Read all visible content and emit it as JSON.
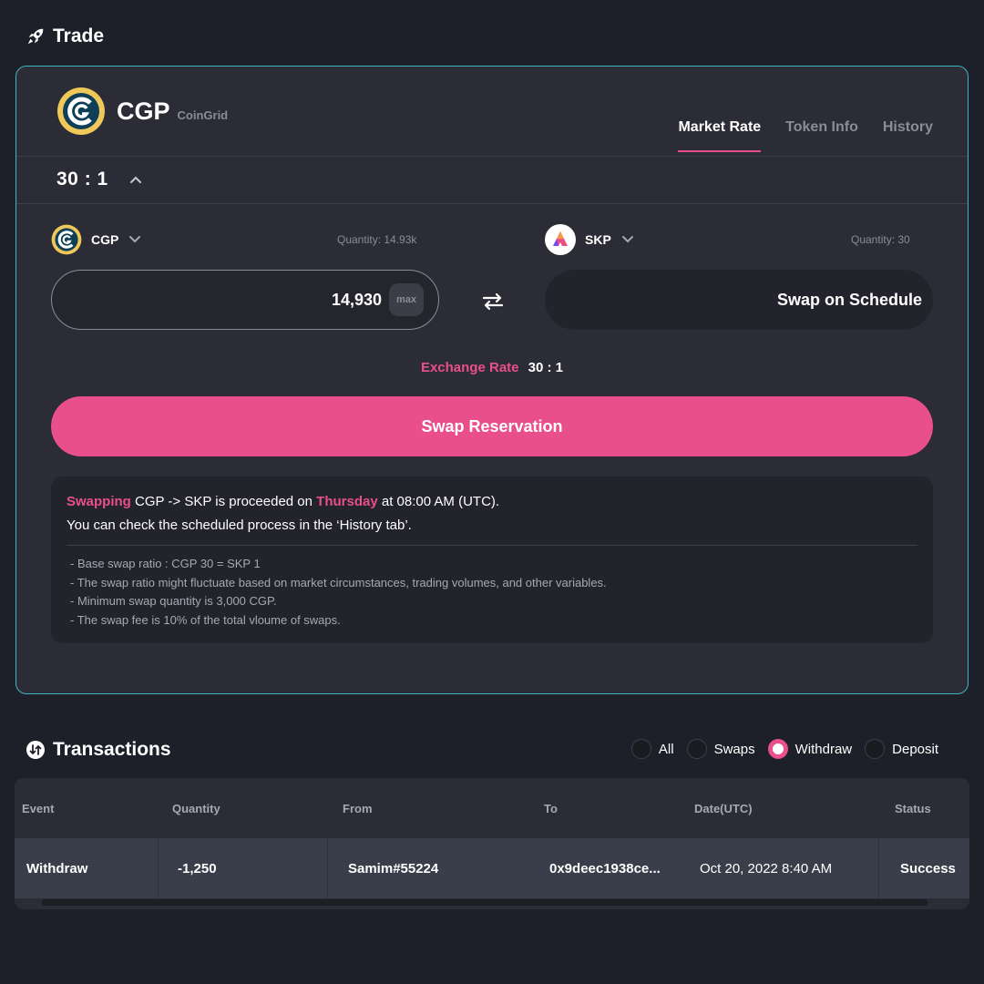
{
  "trade": {
    "title": "Trade",
    "token": {
      "symbol": "CGP",
      "name": "CoinGrid"
    },
    "tabs": [
      "Market Rate",
      "Token Info",
      "History"
    ],
    "ratio": "30 : 1",
    "from": {
      "symbol": "CGP",
      "quantity": "Quantity: 14.93k",
      "amount": "14,930",
      "max_label": "max"
    },
    "to": {
      "symbol": "SKP",
      "quantity": "Quantity: 30",
      "value": "Swap on Schedule"
    },
    "exchange_rate": {
      "label": "Exchange Rate",
      "value": "30 : 1"
    },
    "swap_button": "Swap Reservation",
    "info": {
      "hl1": "Swapping",
      "t1": " CGP -> SKP is proceeded on ",
      "hl2": "Thursday",
      "t2": " at 08:00 AM (UTC).",
      "line2": "You can check the scheduled process in the ‘History tab’.",
      "notes": [
        "- Base swap ratio : CGP 30 = SKP 1",
        "- The swap ratio might fluctuate based on market circumstances, trading volumes, and other variables.",
        "- Minimum swap quantity is 3,000 CGP.",
        "- The swap fee is 10% of the total vloume of swaps."
      ]
    }
  },
  "transactions": {
    "title": "Transactions",
    "filters": [
      "All",
      "Swaps",
      "Withdraw",
      "Deposit"
    ],
    "selected_filter": "Withdraw",
    "columns": [
      "Event",
      "Quantity",
      "From",
      "To",
      "Date(UTC)",
      "Status"
    ],
    "rows": [
      {
        "event": "Withdraw",
        "quantity": "-1,250",
        "from": "Samim#55224",
        "to": "0x9deec1938ce...",
        "date": "Oct 20, 2022 8:40 AM",
        "status": "Success"
      }
    ]
  },
  "colors": {
    "accent": "#e94f8a",
    "card_border": "#3fb6c2",
    "background": "#1e2029"
  }
}
